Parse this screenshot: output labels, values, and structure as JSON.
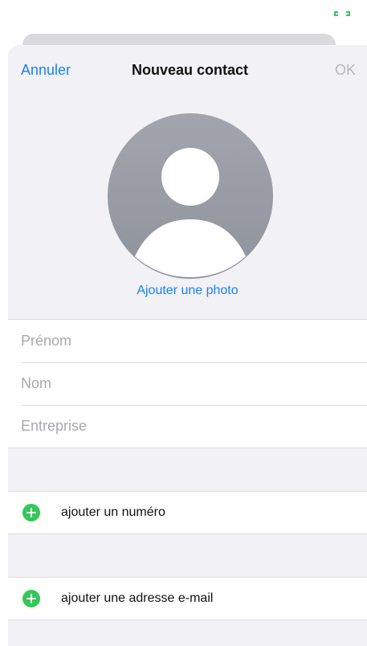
{
  "status": {
    "indicator_icon": "connection-indicator-icon",
    "indicator_color": "#34c759"
  },
  "nav": {
    "cancel_label": "Annuler",
    "title": "Nouveau contact",
    "ok_label": "OK"
  },
  "avatar": {
    "icon": "person-placeholder-icon",
    "add_photo_label": "Ajouter une photo"
  },
  "fields": [
    {
      "placeholder": "Prénom"
    },
    {
      "placeholder": "Nom"
    },
    {
      "placeholder": "Entreprise"
    }
  ],
  "actions": {
    "add_phone_label": "ajouter un numéro",
    "add_email_label": "ajouter une adresse e-mail",
    "add_icon": "add-circle-icon"
  },
  "colors": {
    "accent": "#1a82f0",
    "add_green": "#34c759",
    "disabled": "#b7b7bd",
    "background": "#f1f1f6"
  }
}
